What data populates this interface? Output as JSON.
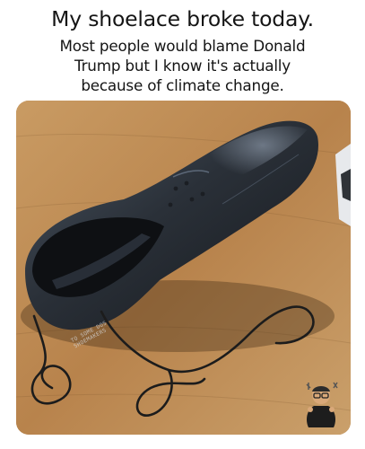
{
  "caption": {
    "headline": "My shoelace broke today.",
    "line1": "Most people would blame Donald",
    "line2": "Trump but I know it's actually",
    "line3": "because of climate change."
  },
  "photo": {
    "insole_text_1": "TO SOME DOS",
    "insole_text_2": "SHOEMAKERS"
  },
  "colors": {
    "background": "#ffffff",
    "caption_text": "#151515",
    "table_wood": "#b88a54",
    "shoe_leather": "#2b2f36",
    "lace": "#1c1c1c"
  },
  "icons": {
    "sticker": "memoji-sticker-icon"
  }
}
